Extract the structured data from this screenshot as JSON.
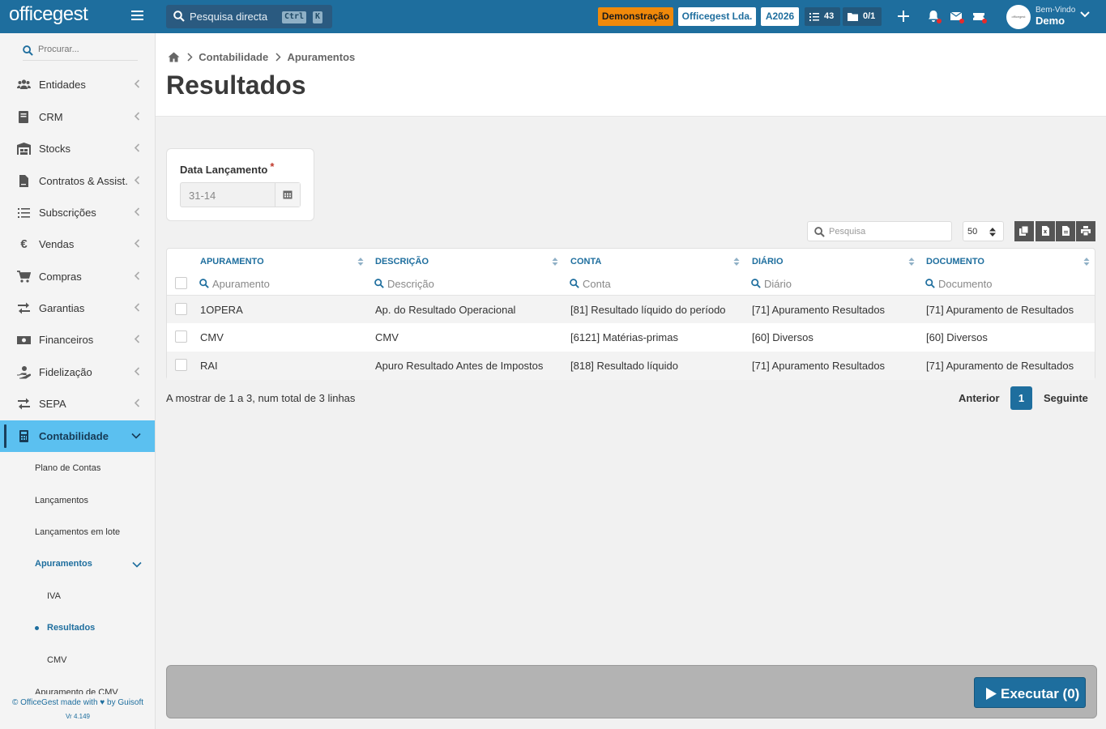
{
  "topbar": {
    "logo": "officegest",
    "logo_sub": "© OfficeGest made with love by Guisoft",
    "search_label": "Pesquisa directa",
    "kbd_ctrl": "Ctrl",
    "kbd_k": "K",
    "badge_demo": "Demonstração",
    "badge_company": "Officegest Lda.",
    "badge_year": "A2026",
    "tasks_count": "43",
    "messages_count": "0/1",
    "welcome": "Bem-Vindo",
    "username": "Demo",
    "colors": {
      "bar": "#1e6e9e",
      "demo": "#f0890a"
    }
  },
  "sidebar": {
    "search_placeholder": "Procurar...",
    "items": [
      {
        "label": "Entidades",
        "icon": "users-icon"
      },
      {
        "label": "CRM",
        "icon": "book-icon"
      },
      {
        "label": "Stocks",
        "icon": "warehouse-icon"
      },
      {
        "label": "Contratos & Assist.",
        "icon": "file-contract-icon"
      },
      {
        "label": "Subscrições",
        "icon": "list-icon"
      },
      {
        "label": "Vendas",
        "icon": "euro-icon"
      },
      {
        "label": "Compras",
        "icon": "cart-icon"
      },
      {
        "label": "Garantias",
        "icon": "exchange-icon"
      },
      {
        "label": "Financeiros",
        "icon": "money-icon"
      },
      {
        "label": "Fidelização",
        "icon": "hand-holding-icon"
      },
      {
        "label": "SEPA",
        "icon": "exchange-icon"
      },
      {
        "label": "Contabilidade",
        "icon": "calculator-icon"
      }
    ],
    "subitems": [
      "Plano de Contas",
      "Lançamentos",
      "Lançamentos em lote",
      "Apuramentos",
      "IVA",
      "Resultados",
      "CMV",
      "Apuramento de CMV"
    ],
    "footer_line1": "© OfficeGest made with",
    "footer_line1b": "by Guisoft",
    "footer_version": "Vr 4.149"
  },
  "header": {
    "breadcrumb": [
      "Contabilidade",
      "Apuramentos"
    ],
    "title": "Resultados"
  },
  "form": {
    "date_label": "Data Lançamento",
    "required_mark": "*",
    "date_value": "31-14"
  },
  "table": {
    "search_placeholder": "Pesquisa",
    "page_size": "50",
    "columns": [
      "APURAMENTO",
      "DESCRIÇÃO",
      "CONTA",
      "DIÁRIO",
      "DOCUMENTO"
    ],
    "filters": [
      "Apuramento",
      "Descrição",
      "Conta",
      "Diário",
      "Documento"
    ],
    "rows": [
      [
        "1OPERA",
        "Ap. do Resultado Operacional",
        "[81] Resultado líquido do período",
        "[71] Apuramento Resultados",
        "[71] Apuramento de Resultados"
      ],
      [
        "CMV",
        "CMV",
        "[6121] Matérias-primas",
        "[60] Diversos",
        "[60] Diversos"
      ],
      [
        "RAI",
        "Apuro Resultado Antes de Impostos",
        "[818] Resultado líquido",
        "[71] Apuramento Resultados",
        "[71] Apuramento de Resultados"
      ]
    ],
    "info": "A mostrar de 1 a 3, num total de 3 linhas",
    "prev": "Anterior",
    "page": "1",
    "next": "Seguinte"
  },
  "footer": {
    "execute_label": "Executar (0)"
  }
}
